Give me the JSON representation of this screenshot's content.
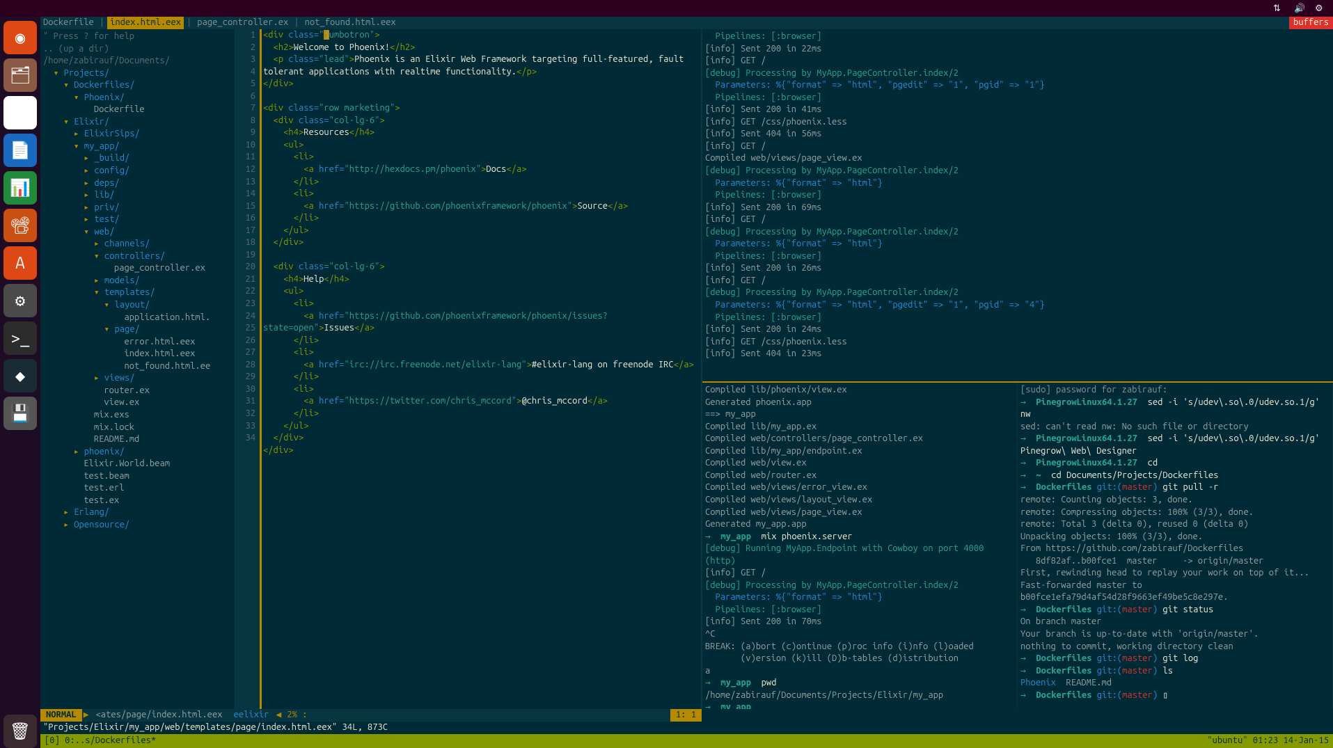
{
  "menubar": {
    "icons": [
      "network-icon",
      "volume-icon",
      "gear-icon"
    ]
  },
  "launcher": {
    "apps": [
      {
        "name": "ubuntu-dash",
        "bg": "#dd4814",
        "glyph": "◉"
      },
      {
        "name": "files",
        "bg": "#8a5a44",
        "glyph": "🗂"
      },
      {
        "name": "chrome",
        "bg": "#ffffff",
        "glyph": "◐"
      },
      {
        "name": "writer",
        "bg": "#1a6bbf",
        "glyph": "📄"
      },
      {
        "name": "calc",
        "bg": "#1f8b3b",
        "glyph": "📊"
      },
      {
        "name": "impress",
        "bg": "#c94f13",
        "glyph": "📽"
      },
      {
        "name": "ubuntu-software",
        "bg": "#dd4814",
        "glyph": "A"
      },
      {
        "name": "settings",
        "bg": "#4a4a4a",
        "glyph": "⚙"
      },
      {
        "name": "terminal",
        "bg": "#2c2c2c",
        "glyph": ">_"
      },
      {
        "name": "app-dark",
        "bg": "#1b2b34",
        "glyph": "◆"
      },
      {
        "name": "save",
        "bg": "#555",
        "glyph": "💾"
      }
    ],
    "trash": {
      "name": "trash",
      "bg": "#3a2a30",
      "glyph": "🗑"
    }
  },
  "tabline": {
    "tabs": [
      {
        "label": "Dockerfile",
        "active": false
      },
      {
        "label": "index.html.eex",
        "active": true
      },
      {
        "label": "page_controller.ex",
        "active": false
      },
      {
        "label": "not_found.html.eex",
        "active": false
      }
    ],
    "buffers_label": "buffers"
  },
  "filetree": {
    "hint": "\" Press ? for help",
    "up": ".. (up a dir)",
    "root": "/home/zabirauf/Documents/",
    "nodes": [
      {
        "d": 0,
        "t": "dir",
        "a": "▾",
        "n": "Projects/"
      },
      {
        "d": 1,
        "t": "dir",
        "a": "▾",
        "n": "Dockerfiles/"
      },
      {
        "d": 2,
        "t": "dir",
        "a": "▾",
        "n": "Phoenix/"
      },
      {
        "d": 3,
        "t": "file",
        "a": " ",
        "n": "Dockerfile"
      },
      {
        "d": 1,
        "t": "dir",
        "a": "▾",
        "n": "Elixir/"
      },
      {
        "d": 2,
        "t": "dir",
        "a": "▸",
        "n": "ElixirSips/"
      },
      {
        "d": 2,
        "t": "dir",
        "a": "▾",
        "n": "my_app/"
      },
      {
        "d": 3,
        "t": "dir",
        "a": "▸",
        "n": "_build/"
      },
      {
        "d": 3,
        "t": "dir",
        "a": "▸",
        "n": "config/"
      },
      {
        "d": 3,
        "t": "dir",
        "a": "▸",
        "n": "deps/"
      },
      {
        "d": 3,
        "t": "dir",
        "a": "▸",
        "n": "lib/"
      },
      {
        "d": 3,
        "t": "dir",
        "a": "▸",
        "n": "priv/"
      },
      {
        "d": 3,
        "t": "dir",
        "a": "▸",
        "n": "test/"
      },
      {
        "d": 3,
        "t": "dir",
        "a": "▾",
        "n": "web/"
      },
      {
        "d": 4,
        "t": "dir",
        "a": "▸",
        "n": "channels/"
      },
      {
        "d": 4,
        "t": "dir",
        "a": "▾",
        "n": "controllers/"
      },
      {
        "d": 5,
        "t": "file",
        "a": " ",
        "n": "page_controller.ex"
      },
      {
        "d": 4,
        "t": "dir",
        "a": "▸",
        "n": "models/"
      },
      {
        "d": 4,
        "t": "dir",
        "a": "▾",
        "n": "templates/"
      },
      {
        "d": 5,
        "t": "dir",
        "a": "▾",
        "n": "layout/"
      },
      {
        "d": 6,
        "t": "file",
        "a": " ",
        "n": "application.html."
      },
      {
        "d": 5,
        "t": "dir",
        "a": "▾",
        "n": "page/"
      },
      {
        "d": 6,
        "t": "file",
        "a": " ",
        "n": "error.html.eex"
      },
      {
        "d": 6,
        "t": "file",
        "a": " ",
        "n": "index.html.eex"
      },
      {
        "d": 6,
        "t": "file",
        "a": " ",
        "n": "not_found.html.ee"
      },
      {
        "d": 4,
        "t": "dir",
        "a": "▸",
        "n": "views/"
      },
      {
        "d": 4,
        "t": "file",
        "a": " ",
        "n": "router.ex"
      },
      {
        "d": 4,
        "t": "file",
        "a": " ",
        "n": "view.ex"
      },
      {
        "d": 3,
        "t": "file",
        "a": " ",
        "n": "mix.exs"
      },
      {
        "d": 3,
        "t": "file",
        "a": " ",
        "n": "mix.lock"
      },
      {
        "d": 3,
        "t": "file",
        "a": " ",
        "n": "README.md"
      },
      {
        "d": 2,
        "t": "dir",
        "a": "▸",
        "n": "phoenix/"
      },
      {
        "d": 2,
        "t": "file",
        "a": " ",
        "n": "Elixir.World.beam"
      },
      {
        "d": 2,
        "t": "file",
        "a": " ",
        "n": "test.beam"
      },
      {
        "d": 2,
        "t": "file",
        "a": " ",
        "n": "test.erl"
      },
      {
        "d": 2,
        "t": "file",
        "a": " ",
        "n": "test.ex"
      },
      {
        "d": 1,
        "t": "dir",
        "a": "▸",
        "n": "Erlang/"
      },
      {
        "d": 1,
        "t": "dir",
        "a": "▸",
        "n": "Opensource/"
      }
    ]
  },
  "editor": {
    "status": {
      "mode": "NORMAL",
      "file": "<ates/page/index.html.eex",
      "filetype": "eelixir",
      "percent": "2%",
      "line": "1",
      "col": "1"
    },
    "message": "\"Projects/Elixir/my_app/web/templates/page/index.html.eex\" 34L, 873C",
    "lines": [
      {
        "n": 1,
        "html": "<span class='kw'>&lt;div</span> <span class='tagn'>class=</span><span class='str'>\"</span><span class='cursor'>j</span><span class='str'>umbotron\"</span><span class='kw'>&gt;</span>"
      },
      {
        "n": 2,
        "html": "  <span class='kw'>&lt;h2&gt;</span><span class='text'>Welcome to Phoenix!</span><span class='kw'>&lt;/h2&gt;</span>"
      },
      {
        "n": 3,
        "html": "  <span class='kw'>&lt;p</span> <span class='tagn'>class=</span><span class='str'>\"lead\"</span><span class='kw'>&gt;</span><span class='text'>Phoenix is an Elixir Web Framework targeting full-featured, fault tolerant applications with realtime functionality.</span><span class='kw'>&lt;/p&gt;</span>"
      },
      {
        "n": 4,
        "html": "<span class='kw'>&lt;/div&gt;</span>"
      },
      {
        "n": 5,
        "html": ""
      },
      {
        "n": 6,
        "html": "<span class='kw'>&lt;div</span> <span class='tagn'>class=</span><span class='str'>\"row marketing\"</span><span class='kw'>&gt;</span>"
      },
      {
        "n": 7,
        "html": "  <span class='kw'>&lt;div</span> <span class='tagn'>class=</span><span class='str'>\"col-lg-6\"</span><span class='kw'>&gt;</span>"
      },
      {
        "n": 8,
        "html": "    <span class='kw'>&lt;h4&gt;</span><span class='text'>Resources</span><span class='kw'>&lt;/h4&gt;</span>"
      },
      {
        "n": 9,
        "html": "    <span class='kw'>&lt;ul&gt;</span>"
      },
      {
        "n": 10,
        "html": "      <span class='kw'>&lt;li&gt;</span>"
      },
      {
        "n": 11,
        "html": "        <span class='kw'>&lt;a</span> <span class='tagn'>href=</span><span class='str'>\"http://hexdocs.pm/phoenix\"</span><span class='kw'>&gt;</span><span class='text'>Docs</span><span class='kw'>&lt;/a&gt;</span>"
      },
      {
        "n": 12,
        "html": "      <span class='kw'>&lt;/li&gt;</span>"
      },
      {
        "n": 13,
        "html": "      <span class='kw'>&lt;li&gt;</span>"
      },
      {
        "n": 14,
        "html": "        <span class='kw'>&lt;a</span> <span class='tagn'>href=</span><span class='str'>\"https://github.com/phoenixframework/phoenix\"</span><span class='kw'>&gt;</span><span class='text'>Source</span><span class='kw'>&lt;/a&gt;</span>"
      },
      {
        "n": 15,
        "html": "      <span class='kw'>&lt;/li&gt;</span>"
      },
      {
        "n": 16,
        "html": "    <span class='kw'>&lt;/ul&gt;</span>"
      },
      {
        "n": 17,
        "html": "  <span class='kw'>&lt;/div&gt;</span>"
      },
      {
        "n": 18,
        "html": ""
      },
      {
        "n": 19,
        "html": "  <span class='kw'>&lt;div</span> <span class='tagn'>class=</span><span class='str'>\"col-lg-6\"</span><span class='kw'>&gt;</span>"
      },
      {
        "n": 20,
        "html": "    <span class='kw'>&lt;h4&gt;</span><span class='text'>Help</span><span class='kw'>&lt;/h4&gt;</span>"
      },
      {
        "n": 21,
        "html": "    <span class='kw'>&lt;ul&gt;</span>"
      },
      {
        "n": 22,
        "html": "      <span class='kw'>&lt;li&gt;</span>"
      },
      {
        "n": 23,
        "html": "        <span class='kw'>&lt;a</span> <span class='tagn'>href=</span><span class='str'>\"https://github.com/phoenixframework/phoenix/issues?state=open\"</span><span class='kw'>&gt;</span><span class='text'>Issues</span><span class='kw'>&lt;/a&gt;</span>"
      },
      {
        "n": 24,
        "html": "      <span class='kw'>&lt;/li&gt;</span>"
      },
      {
        "n": 25,
        "html": "      <span class='kw'>&lt;li&gt;</span>"
      },
      {
        "n": 26,
        "html": "        <span class='kw'>&lt;a</span> <span class='tagn'>href=</span><span class='str'>\"irc://irc.freenode.net/elixir-lang\"</span><span class='kw'>&gt;</span><span class='text'>#elixir-lang on freenode IRC</span><span class='kw'>&lt;/a&gt;</span>"
      },
      {
        "n": 27,
        "html": "      <span class='kw'>&lt;/li&gt;</span>"
      },
      {
        "n": 28,
        "html": "      <span class='kw'>&lt;li&gt;</span>"
      },
      {
        "n": 29,
        "html": "        <span class='kw'>&lt;a</span> <span class='tagn'>href=</span><span class='str'>\"https://twitter.com/chris_mccord\"</span><span class='kw'>&gt;</span><span class='text'>@chris_mccord</span><span class='kw'>&lt;/a&gt;</span>"
      },
      {
        "n": 30,
        "html": "      <span class='kw'>&lt;/li&gt;</span>"
      },
      {
        "n": 31,
        "html": "    <span class='kw'>&lt;/ul&gt;</span>"
      },
      {
        "n": 32,
        "html": "  <span class='kw'>&lt;/div&gt;</span>"
      },
      {
        "n": 33,
        "html": "<span class='kw'>&lt;/div&gt;</span>"
      },
      {
        "n": 34,
        "html": ""
      }
    ]
  },
  "term_top": [
    {
      "c": "pipe",
      "t": "Pipelines: [:browser]"
    },
    {
      "c": "info",
      "t": "[info] Sent 200 in 22ms"
    },
    {
      "c": "info",
      "t": "[info] GET /"
    },
    {
      "c": "debug",
      "t": "[debug] Processing by MyApp.PageController.index/2"
    },
    {
      "c": "param",
      "t": "Parameters: %{\"format\" => \"html\", \"pgedit\" => \"1\", \"pgid\" => \"1\"}"
    },
    {
      "c": "pipe",
      "t": "Pipelines: [:browser]"
    },
    {
      "c": "info",
      "t": "[info] Sent 200 in 41ms"
    },
    {
      "c": "info",
      "t": "[info] GET /css/phoenix.less"
    },
    {
      "c": "info",
      "t": "[info] Sent 404 in 56ms"
    },
    {
      "c": "info",
      "t": "[info] GET /"
    },
    {
      "c": "info",
      "t": "Compiled web/views/page_view.ex"
    },
    {
      "c": "debug",
      "t": "[debug] Processing by MyApp.PageController.index/2"
    },
    {
      "c": "param",
      "t": "Parameters: %{\"format\" => \"html\"}"
    },
    {
      "c": "pipe",
      "t": "Pipelines: [:browser]"
    },
    {
      "c": "info",
      "t": "[info] Sent 200 in 69ms"
    },
    {
      "c": "info",
      "t": "[info] GET /"
    },
    {
      "c": "debug",
      "t": "[debug] Processing by MyApp.PageController.index/2"
    },
    {
      "c": "param",
      "t": "Parameters: %{\"format\" => \"html\"}"
    },
    {
      "c": "pipe",
      "t": "Pipelines: [:browser]"
    },
    {
      "c": "info",
      "t": "[info] Sent 200 in 26ms"
    },
    {
      "c": "info",
      "t": "[info] GET /"
    },
    {
      "c": "debug",
      "t": "[debug] Processing by MyApp.PageController.index/2"
    },
    {
      "c": "param",
      "t": "Parameters: %{\"format\" => \"html\", \"pgedit\" => \"1\", \"pgid\" => \"4\"}"
    },
    {
      "c": "pipe",
      "t": "Pipelines: [:browser]"
    },
    {
      "c": "info",
      "t": "[info] Sent 200 in 24ms"
    },
    {
      "c": "info",
      "t": "[info] GET /css/phoenix.less"
    },
    {
      "c": "info",
      "t": "[info] Sent 404 in 23ms"
    }
  ],
  "term_bl": [
    {
      "c": "info",
      "t": "Compiled lib/phoenix/view.ex"
    },
    {
      "c": "info",
      "t": "Generated phoenix.app"
    },
    {
      "c": "info",
      "t": "==> my_app"
    },
    {
      "c": "info",
      "t": "Compiled lib/my_app.ex"
    },
    {
      "c": "info",
      "t": "Compiled web/controllers/page_controller.ex"
    },
    {
      "c": "info",
      "t": "Compiled lib/my_app/endpoint.ex"
    },
    {
      "c": "info",
      "t": "Compiled web/view.ex"
    },
    {
      "c": "info",
      "t": "Compiled web/router.ex"
    },
    {
      "c": "info",
      "t": "Compiled web/views/error_view.ex"
    },
    {
      "c": "info",
      "t": "Compiled web/views/layout_view.ex"
    },
    {
      "c": "info",
      "t": "Compiled web/views/page_view.ex"
    },
    {
      "c": "info",
      "t": "Generated my_app.app"
    },
    {
      "c": "prompt",
      "path": "my_app",
      "cmd": "mix phoenix.server"
    },
    {
      "c": "debug",
      "t": "[debug] Running MyApp.Endpoint with Cowboy on port 4000 (http)"
    },
    {
      "c": "info",
      "t": "[info] GET /"
    },
    {
      "c": "debug",
      "t": "[debug] Processing by MyApp.PageController.index/2"
    },
    {
      "c": "param",
      "t": "Parameters: %{\"format\" => \"html\"}"
    },
    {
      "c": "pipe",
      "t": "Pipelines: [:browser]"
    },
    {
      "c": "info",
      "t": "[info] Sent 200 in 70ms"
    },
    {
      "c": "info",
      "t": "^C"
    },
    {
      "c": "info",
      "t": "BREAK: (a)bort (c)ontinue (p)roc info (i)nfo (l)oaded"
    },
    {
      "c": "info",
      "t": "       (v)ersion (k)ill (D)b-tables (d)istribution"
    },
    {
      "c": "info",
      "t": "a"
    },
    {
      "c": "prompt",
      "path": "my_app",
      "cmd": "pwd"
    },
    {
      "c": "info",
      "t": "/home/zabirauf/Documents/Projects/Elixir/my_app"
    },
    {
      "c": "prompt",
      "path": "my_app",
      "cmd": ""
    }
  ],
  "term_br": [
    {
      "c": "sudo",
      "t": "[sudo] password for zabirauf:"
    },
    {
      "c": "prompt2",
      "path": "PinegrowLinux64.1.27",
      "cmd": "sed -i 's/udev\\.so\\.0/udev.so.1/g' nw"
    },
    {
      "c": "info",
      "t": "sed: can't read nw: No such file or directory"
    },
    {
      "c": "prompt2",
      "path": "PinegrowLinux64.1.27",
      "cmd": "sed -i 's/udev\\.so\\.0/udev.so.1/g' Pinegrow\\ Web\\ Designer"
    },
    {
      "c": "prompt2",
      "path": "PinegrowLinux64.1.27",
      "cmd": "cd"
    },
    {
      "c": "prompt2",
      "path": "~",
      "cmd": "cd Documents/Projects/Dockerfiles"
    },
    {
      "c": "gitprompt",
      "path": "Dockerfiles",
      "branch": "master",
      "cmd": "git pull -r"
    },
    {
      "c": "info",
      "t": "remote: Counting objects: 3, done."
    },
    {
      "c": "info",
      "t": "remote: Compressing objects: 100% (3/3), done."
    },
    {
      "c": "info",
      "t": "remote: Total 3 (delta 0), reused 0 (delta 0)"
    },
    {
      "c": "info",
      "t": "Unpacking objects: 100% (3/3), done."
    },
    {
      "c": "info",
      "t": "From https://github.com/zabirauf/Dockerfiles"
    },
    {
      "c": "info",
      "t": "   8df82af..b00fce1  master     -> origin/master"
    },
    {
      "c": "info",
      "t": "First, rewinding head to replay your work on top of it..."
    },
    {
      "c": "info",
      "t": "Fast-forwarded master to b00fce1efa79d4af54d28f9663ef49be5c8e297e."
    },
    {
      "c": "gitprompt",
      "path": "Dockerfiles",
      "branch": "master",
      "cmd": "git status"
    },
    {
      "c": "info",
      "t": "On branch master"
    },
    {
      "c": "info",
      "t": "Your branch is up-to-date with 'origin/master'."
    },
    {
      "c": "info",
      "t": ""
    },
    {
      "c": "info",
      "t": "nothing to commit, working directory clean"
    },
    {
      "c": "gitprompt",
      "path": "Dockerfiles",
      "branch": "master",
      "cmd": "git log"
    },
    {
      "c": "gitprompt",
      "path": "Dockerfiles",
      "branch": "master",
      "cmd": "ls"
    },
    {
      "c": "ls",
      "t": "Phoenix  README.md"
    },
    {
      "c": "gitprompt",
      "path": "Dockerfiles",
      "branch": "master",
      "cmd": "▯"
    }
  ],
  "tmux": {
    "left": "[0] 0:..s/Dockerfiles*",
    "right": "\"ubuntu\" 01:23 14-Jan-15"
  }
}
